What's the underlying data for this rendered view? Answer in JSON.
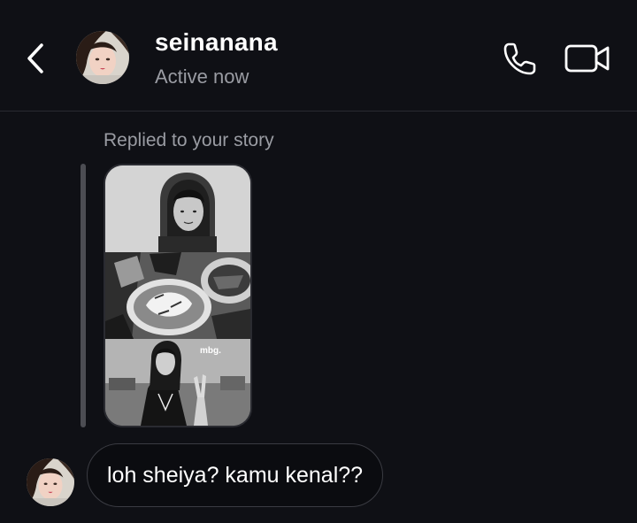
{
  "header": {
    "contact_name": "seinanana",
    "status": "Active now",
    "icons": {
      "back": "chevron-left-icon",
      "call": "phone-icon",
      "video": "video-camera-icon"
    }
  },
  "thread": {
    "reply_caption": "Replied to your story",
    "story": {
      "watermark": "mbg."
    },
    "messages": [
      {
        "text": "loh sheiya? kamu kenal??",
        "from": "contact"
      }
    ]
  },
  "colors": {
    "background": "#0f1015",
    "secondary_text": "#9a9ca3",
    "bubble_border": "#3a3b42",
    "reply_bar": "#4c4d53"
  }
}
